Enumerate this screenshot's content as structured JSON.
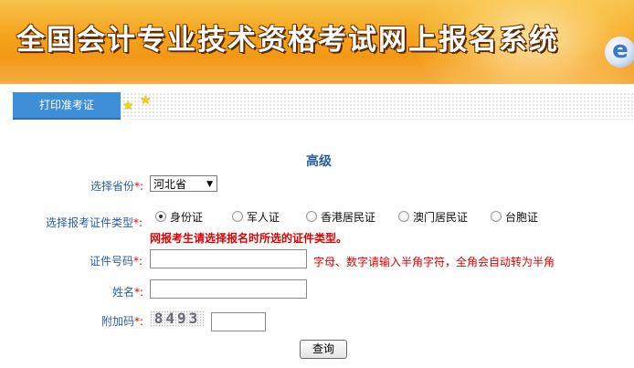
{
  "header": {
    "title": "全国会计专业技术资格考试网上报名系统",
    "logo_letter": "e"
  },
  "tabs": [
    {
      "label": "打印准考证"
    }
  ],
  "form": {
    "section_title": "高级",
    "required_mark": "*:",
    "province": {
      "label": "选择省份",
      "value": "河北省"
    },
    "id_type": {
      "label": "选择报考证件类型",
      "options": [
        "身份证",
        "军人证",
        "香港居民证",
        "澳门居民证",
        "台胞证"
      ],
      "selected": "身份证",
      "notice": "网报考生请选择报名时所选的证件类型。"
    },
    "id_number": {
      "label": "证件号码",
      "value": "",
      "hint": "字母、数字请输入半角字符，全角会自动转为半角"
    },
    "name": {
      "label": "姓名",
      "value": ""
    },
    "captcha": {
      "label": "附加码",
      "code": "8493",
      "value": ""
    },
    "submit_label": "查询"
  },
  "colors": {
    "accent": "#3f8fd8",
    "label": "#2a5f9e",
    "error": "#e00000",
    "banner": "#f4a21a"
  }
}
